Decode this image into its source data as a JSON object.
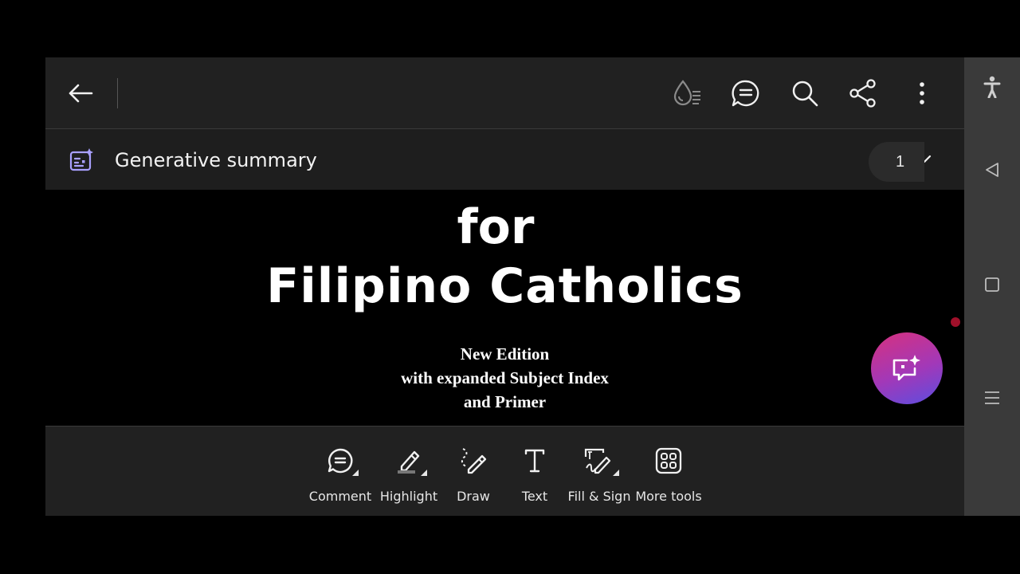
{
  "topbar": {
    "icons": [
      "back-arrow-icon",
      "liquid-mode-icon",
      "comments-list-icon",
      "search-icon",
      "share-icon",
      "more-options-icon"
    ]
  },
  "generative_summary": {
    "label": "Generative summary",
    "icon": "generative-summary-icon",
    "chevron": "chevron-down-icon"
  },
  "document": {
    "title_line1": "for",
    "title_line2": "Filipino Catholics",
    "subtitle_line1": "New Edition",
    "subtitle_line2": "with expanded Subject Index",
    "subtitle_line3": "and Primer",
    "page_number": "1"
  },
  "toolbar": {
    "tools": [
      {
        "label": "Comment",
        "icon": "comment-icon"
      },
      {
        "label": "Highlight",
        "icon": "highlight-icon"
      },
      {
        "label": "Draw",
        "icon": "draw-icon"
      },
      {
        "label": "Text",
        "icon": "text-icon"
      },
      {
        "label": "Fill & Sign",
        "icon": "fill-sign-icon"
      },
      {
        "label": "More tools",
        "icon": "more-tools-icon"
      }
    ]
  },
  "colors": {
    "app_bg": "#1e1e1e",
    "document_bg": "#000000",
    "accent_icon": "#a9a0ff",
    "fab_gradient": [
      "#d7317e",
      "#a238b8",
      "#5b4ee0"
    ],
    "system_nav_bg": "#3a3a3a"
  },
  "system_nav": {
    "icons": [
      "accessibility-icon",
      "back-triangle-icon",
      "home-square-icon",
      "recents-icon"
    ]
  }
}
